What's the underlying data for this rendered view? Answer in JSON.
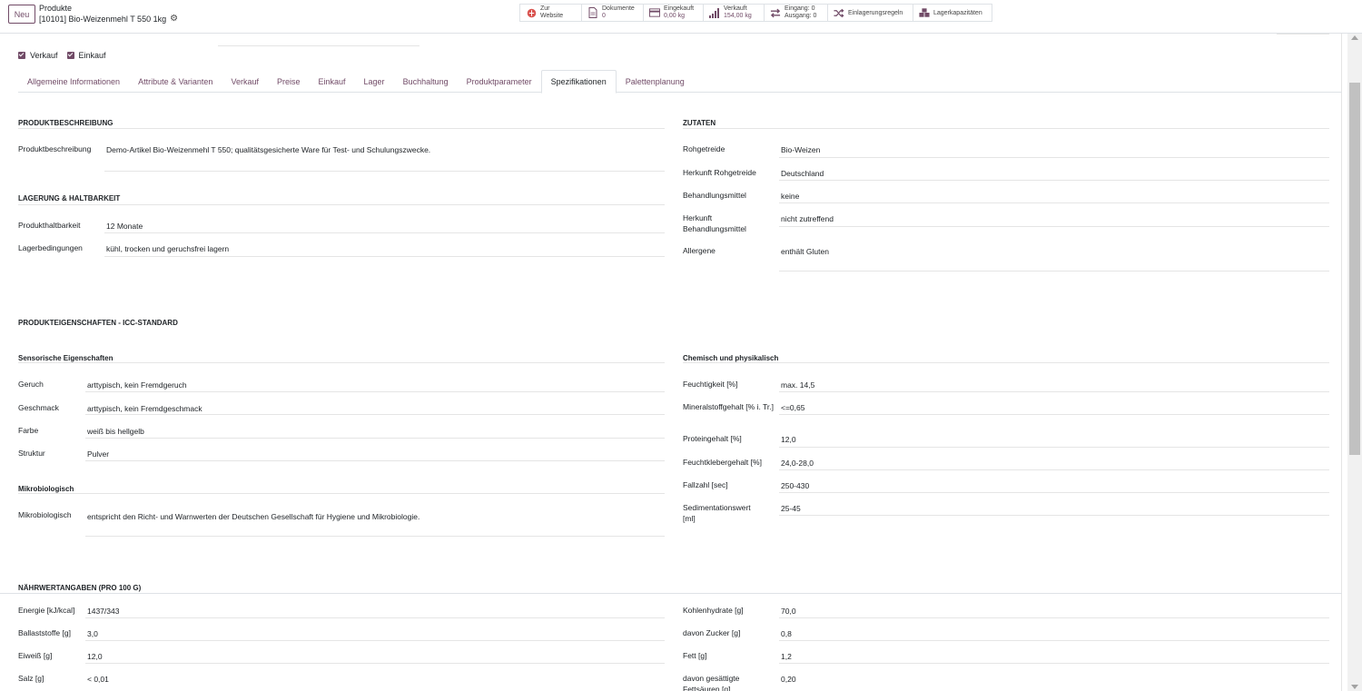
{
  "header": {
    "new_button": "Neu",
    "breadcrumb_parent": "Produkte",
    "breadcrumb_current": "[10101] Bio-Weizenmehl T 550 1kg"
  },
  "smart_buttons": {
    "website": {
      "l1": "Zur",
      "l2": "Website",
      "icon": "globe-icon"
    },
    "documents": {
      "l1": "Dokumente",
      "l2": "0",
      "icon": "document-icon"
    },
    "purchase": {
      "l1": "Eingekauft",
      "l2": "0,00 kg",
      "icon": "credit-card-icon"
    },
    "sales": {
      "l1": "Verkauft",
      "l2": "154,00 kg",
      "icon": "bar-chart-icon"
    },
    "moves": {
      "l1": "Eingang: 0",
      "l2": "Ausgang: 0",
      "icon": "exchange-icon"
    },
    "putaway": {
      "label": "Einlagerungsregeln",
      "icon": "shuffle-icon"
    },
    "capacity": {
      "label": "Lagerkapazitäten",
      "icon": "cubes-icon"
    }
  },
  "checkboxes": {
    "sale": "Verkauf",
    "purchase": "Einkauf"
  },
  "tabs": [
    "Allgemeine Informationen",
    "Attribute & Varianten",
    "Verkauf",
    "Preise",
    "Einkauf",
    "Lager",
    "Buchhaltung",
    "Produktparameter",
    "Spezifikationen",
    "Palettenplanung"
  ],
  "active_tab": "Spezifikationen",
  "left": {
    "description_title": "PRODUKTBESCHREIBUNG",
    "description_label": "Produktbeschreibung",
    "description_value": "Demo-Artikel Bio-Weizenmehl T 550; qualitätsgesicherte Ware für Test- und Schulungszwecke.",
    "storage_title": "LAGERUNG & HALTBARKEIT",
    "shelf_label": "Produkthaltbarkeit",
    "shelf_value": "12 Monate",
    "storage_label": "Lagerbedingungen",
    "storage_value": "kühl, trocken und geruchsfrei lagern"
  },
  "ingredients": {
    "title": "ZUTATEN",
    "rows": [
      {
        "label": "Rohgetreide",
        "value": "Bio-Weizen"
      },
      {
        "label": "Herkunft Rohgetreide",
        "value": "Deutschland"
      },
      {
        "label": "Behandlungsmittel",
        "value": "keine"
      },
      {
        "label": "Herkunft Behandlungsmittel",
        "value": "nicht zutreffend"
      },
      {
        "label": "Allergene",
        "value": "enthält Gluten"
      }
    ]
  },
  "icc": {
    "title": "PRODUKTEIGENSCHAFTEN - ICC-STANDARD",
    "sensory_title": "Sensorische Eigenschaften",
    "sensory": [
      {
        "label": "Geruch",
        "value": "arttypisch, kein Fremdgeruch"
      },
      {
        "label": "Geschmack",
        "value": "arttypisch, kein Fremdgeschmack"
      },
      {
        "label": "Farbe",
        "value": "weiß bis hellgelb"
      },
      {
        "label": "Struktur",
        "value": "Pulver"
      }
    ],
    "micro_title": "Mikrobiologisch",
    "micro_label": "Mikrobiologisch",
    "micro_value": "entspricht den Richt- und Warnwerten der Deutschen Gesellschaft für Hygiene und Mikrobiologie.",
    "chem_title": "Chemisch und physikalisch",
    "chem": [
      {
        "label": "Feuchtigkeit [%]",
        "value": "max. 14,5"
      },
      {
        "label": "Mineralstoffgehalt [% i. Tr.]",
        "value": "<=0,65"
      },
      {
        "label": "Proteingehalt [%]",
        "value": "12,0"
      },
      {
        "label": "Feuchtklebergehalt [%]",
        "value": "24,0-28,0"
      },
      {
        "label": "Fallzahl [sec]",
        "value": "250-430"
      },
      {
        "label": "Sedimentationswert [ml]",
        "value": "25-45"
      }
    ]
  },
  "nutrition": {
    "title": "NÄHRWERTANGABEN (PRO 100 G)",
    "left": [
      {
        "label": "Energie [kJ/kcal]",
        "value": "1437/343"
      },
      {
        "label": "Ballaststoffe [g]",
        "value": "3,0"
      },
      {
        "label": "Eiweiß [g]",
        "value": "12,0"
      },
      {
        "label": "Salz [g]",
        "value": "< 0,01"
      }
    ],
    "right": [
      {
        "label": "Kohlenhydrate [g]",
        "value": "70,0"
      },
      {
        "label": "davon Zucker [g]",
        "value": "0,8"
      },
      {
        "label": "Fett [g]",
        "value": "1,2"
      },
      {
        "label": "davon gesättigte Fettsäuren [g]",
        "value": "0,20"
      }
    ]
  },
  "colors": {
    "accent": "#714B67",
    "border": "#dee2e6"
  }
}
